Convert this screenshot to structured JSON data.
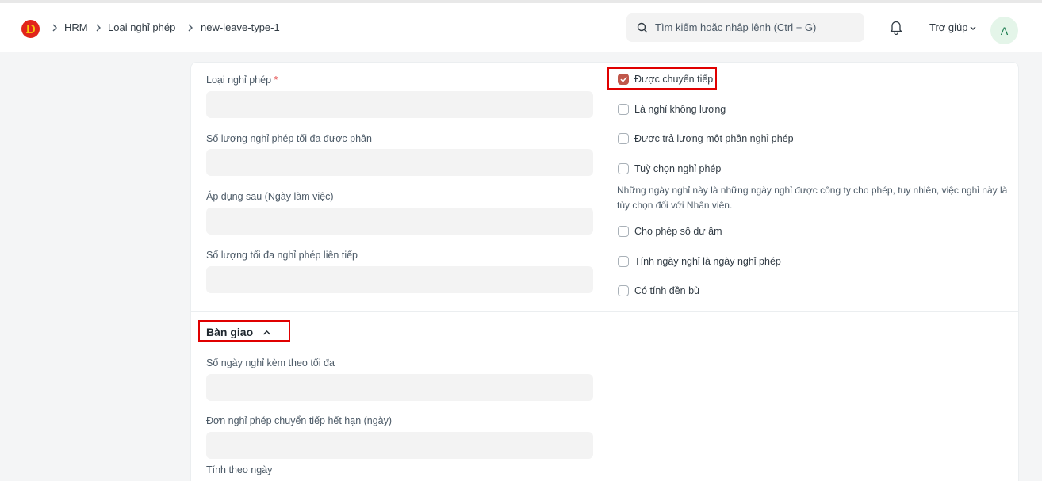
{
  "navbar": {
    "logo_letter": "Đ",
    "breadcrumbs": [
      "HRM",
      "Loại nghỉ phép",
      "new-leave-type-1"
    ],
    "search_placeholder": "Tìm kiếm hoặc nhập lệnh (Ctrl + G)",
    "help_label": "Trợ giúp",
    "avatar_letter": "A"
  },
  "form": {
    "fields_left": [
      {
        "label": "Loại nghỉ phép",
        "required_mark": "*",
        "value": ""
      },
      {
        "label": "Số lượng nghỉ phép tối đa được phân",
        "value": ""
      },
      {
        "label": "Áp dụng sau (Ngày làm việc)",
        "value": ""
      },
      {
        "label": "Số lượng tối đa nghỉ phép liên tiếp",
        "value": ""
      }
    ],
    "checkboxes": [
      {
        "label": "Được chuyển tiếp",
        "checked": true
      },
      {
        "label": "Là nghỉ không lương",
        "checked": false
      },
      {
        "label": "Được trả lương một phần nghỉ phép",
        "checked": false
      },
      {
        "label": "Tuỳ chọn nghỉ phép",
        "checked": false
      },
      {
        "label": "Cho phép số dư âm",
        "checked": false
      },
      {
        "label": "Tính ngày nghỉ là ngày nghỉ phép",
        "checked": false
      },
      {
        "label": "Có tính đền bù",
        "checked": false
      }
    ],
    "optional_leave_description": "Những ngày nghỉ này là những ngày nghỉ được công ty cho phép, tuy nhiên, việc nghỉ này là tùy chọn đối với Nhân viên.",
    "handover_section": {
      "title": "Bàn giao",
      "fields": [
        {
          "label": "Số ngày nghỉ kèm theo tối đa",
          "value": ""
        },
        {
          "label": "Đơn nghỉ phép chuyển tiếp hết hạn (ngày)",
          "value": ""
        },
        {
          "label": "Tính theo ngày",
          "value": ""
        }
      ]
    }
  },
  "colors": {
    "accent_checkbox": "#c0574a",
    "highlight_box": "#e00000",
    "logo_red": "#e1251b",
    "logo_yellow": "#f6c90e"
  }
}
